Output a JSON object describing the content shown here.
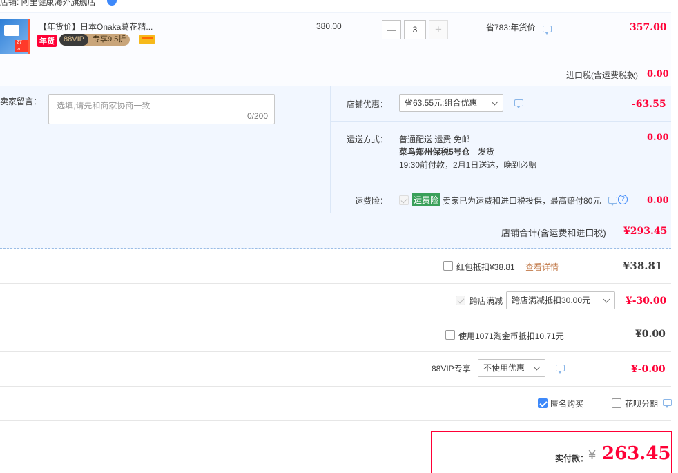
{
  "shop": {
    "name": "店铺: 阿里健康海外旗舰店"
  },
  "item": {
    "title": "【年货价】日本Onaka葛花精...",
    "badge_year": "年货",
    "badge_vip": "88VIP",
    "badge_discount": "专享9.5折",
    "price": "380.00",
    "qty": "3",
    "minus": "—",
    "plus": "+",
    "saving": "省783:年货价",
    "subtotal": "357.00",
    "thumb_text": "27元"
  },
  "import_tax": {
    "label": "进口税(含运费税款)",
    "value": "0.00"
  },
  "message": {
    "label": "给卖家留言：",
    "placeholder": "选填,请先和商家协商一致",
    "count": "0/200"
  },
  "shop_discount": {
    "label": "店铺优惠：",
    "selected": "省63.55元:组合优惠",
    "value": "-63.55"
  },
  "shipping": {
    "label": "运送方式：",
    "line1": "普通配送 运费 免邮",
    "line2a": "菜鸟郑州保税5号仓",
    "line2b": "发货",
    "line3": "19:30前付款，2月1日送达，晚到必赔",
    "value": "0.00"
  },
  "freight_insurance": {
    "label": "运费险：",
    "tag": "运费险",
    "desc": "卖家已为运费和进口税投保，最高赔付80元",
    "value": "0.00"
  },
  "shop_total": {
    "label": "店铺合计(含运费和进口税)",
    "value": "¥293.45"
  },
  "red_packet": {
    "label": "红包抵扣¥38.81",
    "link": "查看详情",
    "value": "¥38.81"
  },
  "cross_store": {
    "label": "跨店满减",
    "selected": "跨店满减抵扣30.00元",
    "value": "¥-30.00"
  },
  "taojinbi": {
    "label": "使用1071淘金币抵扣10.71元",
    "value": "¥0.00"
  },
  "vip88": {
    "label": "88VIP专享",
    "selected": "不使用优惠",
    "value": "¥-0.00"
  },
  "options": {
    "anonymous": "匿名购买",
    "huabei": "花呗分期"
  },
  "payment": {
    "label": "实付款：",
    "currency": "¥",
    "value": "263.45"
  },
  "colors": {
    "accent_red": "#ff0036",
    "light_blue_bg": "#f2f7ff",
    "checkbox_blue": "#3e89fa"
  }
}
